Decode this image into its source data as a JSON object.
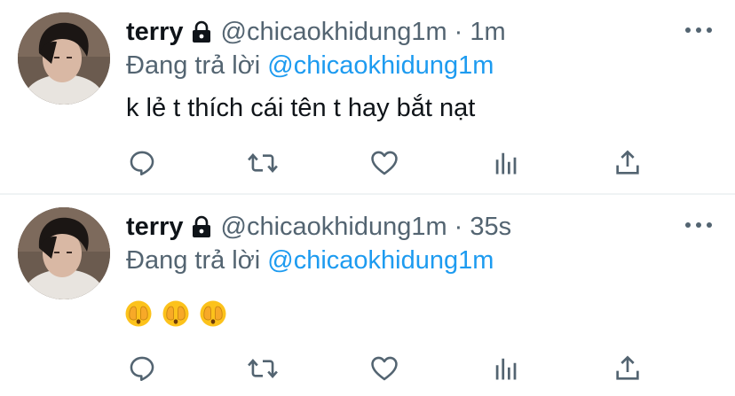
{
  "tweets": [
    {
      "author_name": "terry",
      "handle": "@chicaokhidung1m",
      "separator": "·",
      "time": "1m",
      "reply_prefix": "Đang trả lời",
      "reply_to": "@chicaokhidung1m",
      "text": "k lẻ t thích cái tên t hay bắt nạt",
      "emojis": []
    },
    {
      "author_name": "terry",
      "handle": "@chicaokhidung1m",
      "separator": "·",
      "time": "35s",
      "reply_prefix": "Đang trả lời",
      "reply_to": "@chicaokhidung1m",
      "text": "",
      "emojis": [
        "face-with-hands-over-eyes",
        "face-with-hands-over-eyes",
        "face-with-hands-over-eyes"
      ]
    }
  ],
  "icons": {
    "lock": "lock-icon",
    "more": "more-options-icon",
    "reply": "reply-icon",
    "retweet": "retweet-icon",
    "like": "heart-icon",
    "stats": "stats-icon",
    "share": "share-icon"
  },
  "colors": {
    "text": "#0f1419",
    "secondary": "#536471",
    "link": "#1d9bf0",
    "divider": "#eff3f4"
  }
}
